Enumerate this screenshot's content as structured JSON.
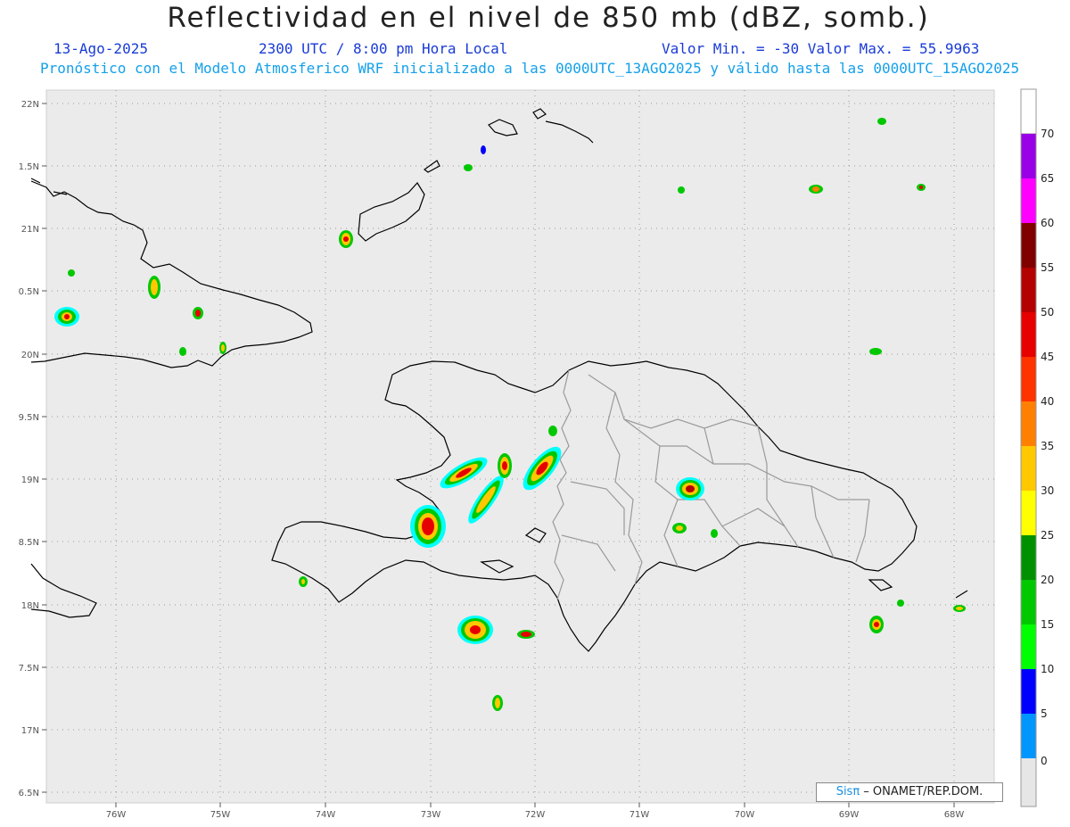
{
  "header": {
    "title": "Reflectividad en el nivel de 850 mb (dBZ, somb.)",
    "date": "13-Ago-2025",
    "time": "2300 UTC / 8:00 pm Hora Local",
    "stats": "Valor Min. = -30  Valor Max. = 55.9963",
    "forecast_line": "Pronóstico con el Modelo Atmosferico WRF inicializado a las 0000UTC_13AGO2025 y válido hasta las  0000UTC_15AGO2025"
  },
  "map": {
    "background_color": "#ebebeb",
    "lon_ticks": [
      "76W",
      "75W",
      "74W",
      "73W",
      "72W",
      "71W",
      "70W",
      "69W",
      "68W"
    ],
    "lat_ticks": [
      "22N",
      "1.5N",
      "21N",
      "0.5N",
      "20N",
      "9.5N",
      "19N",
      "8.5N",
      "18N",
      "7.5N",
      "17N",
      "6.5N"
    ],
    "grid": "dotted"
  },
  "colorbar": {
    "labels": [
      "70",
      "65",
      "60",
      "55",
      "50",
      "45",
      "40",
      "35",
      "30",
      "25",
      "20",
      "15",
      "10",
      "5",
      "0"
    ],
    "colors": [
      "#9a00e6",
      "#ff00ff",
      "#800000",
      "#b30000",
      "#e60000",
      "#ff3300",
      "#ff8000",
      "#ffc800",
      "#ffff00",
      "#009000",
      "#00c800",
      "#00ff00",
      "#0000ff",
      "#0096ff",
      "#00ffff",
      "#e6e6e6"
    ]
  },
  "credit": {
    "brand": "Sisπ",
    "text": " – ONAMET/REP.DOM."
  }
}
